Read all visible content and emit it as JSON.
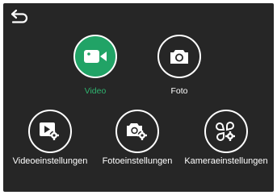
{
  "colors": {
    "background": "#262626",
    "accent": "#21a366",
    "accent_text": "#2fb36f",
    "foreground": "#ffffff"
  },
  "back": {
    "icon": "back-arrow-icon"
  },
  "modes": [
    {
      "label": "Video",
      "icon": "video-camera-icon",
      "active": true
    },
    {
      "label": "Foto",
      "icon": "photo-camera-icon",
      "active": false
    }
  ],
  "settings": [
    {
      "label": "Videoeinstellungen",
      "icon": "video-settings-icon"
    },
    {
      "label": "Fotoeinstellungen",
      "icon": "photo-settings-icon"
    },
    {
      "label": "Kameraeinstellungen",
      "icon": "camera-settings-icon"
    }
  ]
}
